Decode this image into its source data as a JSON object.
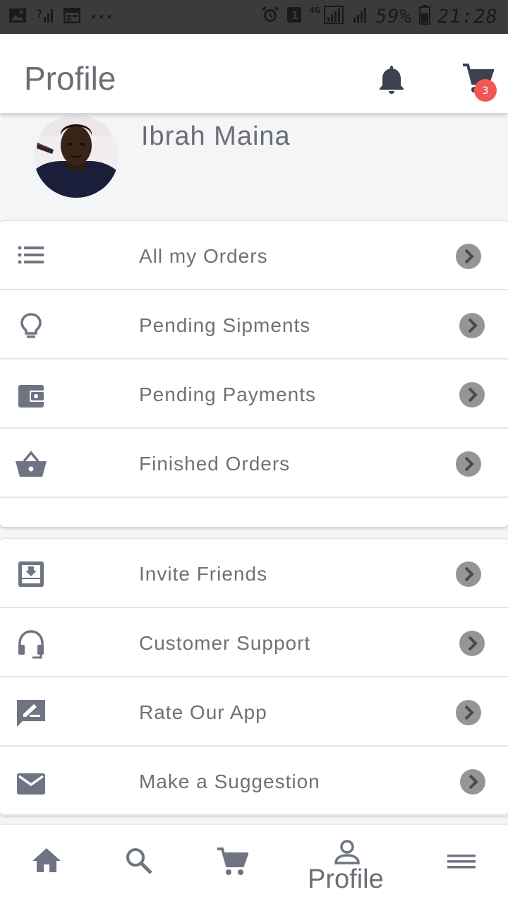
{
  "status_bar": {
    "battery": "59%",
    "time": "21:28",
    "network": "4G",
    "more": "···"
  },
  "header": {
    "title": "Profile",
    "cart_badge_count": "3"
  },
  "profile": {
    "name": "Ibrah Maina"
  },
  "orders_menu": [
    {
      "label": "All my Orders",
      "icon": "list-icon"
    },
    {
      "label": "Pending Sipments",
      "icon": "lightbulb-icon"
    },
    {
      "label": "Pending Payments",
      "icon": "wallet-icon"
    },
    {
      "label": "Finished Orders",
      "icon": "basket-icon"
    }
  ],
  "support_menu": [
    {
      "label": "Invite Friends",
      "icon": "inbox-download-icon"
    },
    {
      "label": "Customer Support",
      "icon": "headset-icon"
    },
    {
      "label": "Rate Our App",
      "icon": "rate-review-icon"
    },
    {
      "label": "Make a Suggestion",
      "icon": "mail-icon"
    }
  ],
  "bottom_nav": {
    "active_label": "Profile",
    "items": [
      "home-icon",
      "search-icon",
      "cart-icon",
      "person-icon",
      "menu-icon"
    ]
  },
  "colors": {
    "icon": "#6f7483",
    "text": "#6f7178",
    "chevron_bg": "#949597",
    "badge": "#f25757"
  }
}
